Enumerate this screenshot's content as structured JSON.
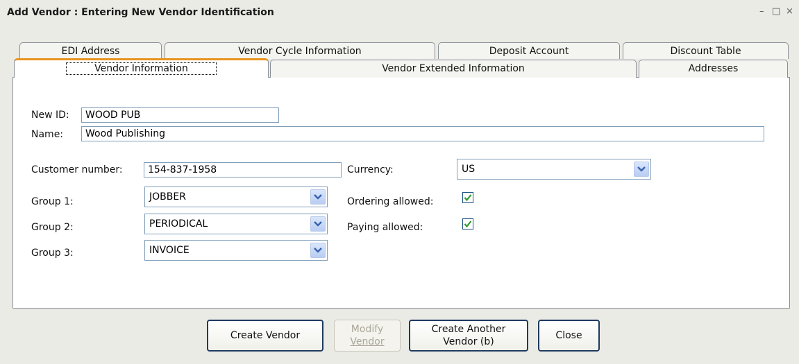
{
  "window": {
    "title": "Add Vendor : Entering New Vendor Identification",
    "controls": {
      "minimize": "–",
      "maximize": "□",
      "close": "×"
    }
  },
  "tabs": {
    "row1": [
      "EDI Address",
      "Vendor Cycle Information",
      "Deposit Account",
      "Discount Table"
    ],
    "row2": [
      "Vendor Information",
      "Vendor Extended Information",
      "Addresses"
    ],
    "active": "Vendor Information"
  },
  "form": {
    "new_id_label": "New ID:",
    "new_id_value": "WOOD PUB",
    "name_label": "Name:",
    "name_value": "Wood Publishing",
    "customer_number_label": "Customer number:",
    "customer_number_value": "154-837-1958",
    "currency_label": "Currency:",
    "currency_value": "US",
    "group1_label": "Group 1:",
    "group1_value": "JOBBER",
    "group2_label": "Group 2:",
    "group2_value": "PERIODICAL",
    "group3_label": "Group 3:",
    "group3_value": "INVOICE",
    "ordering_label": "Ordering allowed:",
    "ordering_checked": true,
    "paying_label": "Paying allowed:",
    "paying_checked": true
  },
  "buttons": {
    "create_vendor": "Create Vendor",
    "modify_vendor_line1": "Modify",
    "modify_vendor_line2": "Vendor",
    "create_another_line1": "Create Another",
    "create_another_line2": "Vendor (b)",
    "close": "Close"
  },
  "colors": {
    "active_tab_accent": "#e8941a",
    "check_green": "#2e9a2e",
    "button_border": "#1e3a5f"
  }
}
